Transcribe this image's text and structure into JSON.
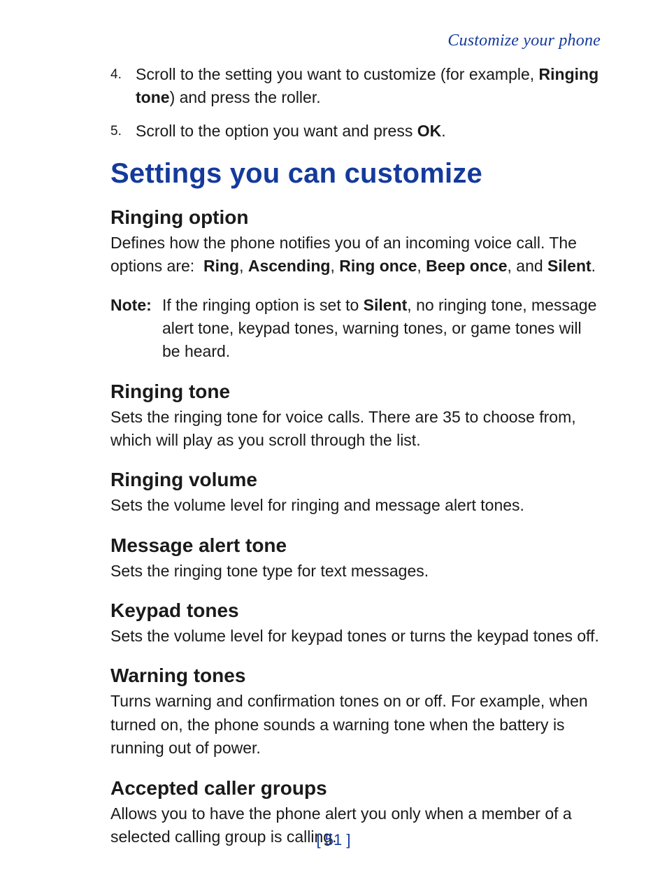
{
  "header": "Customize your phone",
  "steps": [
    {
      "num": "4.",
      "prefix": "Scroll to the setting you want to customize (for example, ",
      "bold": "Ringing tone",
      "suffix": ") and press the roller."
    },
    {
      "num": "5.",
      "prefix": "Scroll to the option you want and press ",
      "bold": "OK",
      "suffix": "."
    }
  ],
  "main_heading": "Settings you can customize",
  "ringing_option": {
    "title": "Ringing option",
    "intro": "Defines how the phone notifies you of an incoming voice call. The options are:  ",
    "opt1": "Ring",
    "sep1": ", ",
    "opt2": "Ascending",
    "sep2": ", ",
    "opt3": "Ring once",
    "sep3": ", ",
    "opt4": "Beep once",
    "sep4": ", and ",
    "opt5": "Silent",
    "end": "."
  },
  "note": {
    "label": "Note:",
    "prefix": "If the ringing option is set to ",
    "bold": "Silent",
    "suffix": ", no ringing tone, message alert tone, keypad tones, warning tones, or game tones will be heard."
  },
  "ringing_tone": {
    "title": "Ringing tone",
    "body": "Sets the ringing tone for voice calls. There are 35 to choose from, which will play as you scroll through the list."
  },
  "ringing_volume": {
    "title": "Ringing volume",
    "body": "Sets the volume level for ringing and message alert tones."
  },
  "message_alert": {
    "title": "Message alert tone",
    "body": "Sets the ringing tone type for text messages."
  },
  "keypad_tones": {
    "title": "Keypad tones",
    "body": "Sets the volume level for keypad tones or turns the keypad tones off."
  },
  "warning_tones": {
    "title": "Warning tones",
    "body": "Turns warning and confirmation tones on or off. For example, when turned on, the phone sounds a warning tone when the battery is running out of power."
  },
  "accepted_caller": {
    "title": "Accepted caller groups",
    "body": "Allows you to have the phone alert you only when a member of a selected calling group is calling."
  },
  "footer": "[ 51 ]"
}
